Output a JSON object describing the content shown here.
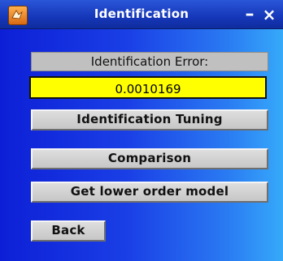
{
  "window": {
    "title": "Identification",
    "minimize_glyph": "–",
    "close_glyph": "×",
    "icon": "matlab-logo-icon"
  },
  "identification": {
    "error_label": "Identification Error:",
    "error_value": "0.0010169"
  },
  "buttons": {
    "identification_tuning": "Identification Tuning",
    "comparison": "Comparison",
    "lower_order_model": "Get lower order model",
    "back": "Back"
  },
  "colors": {
    "error_value_background": "#ffff00",
    "window_gradient_start": "#0d1fd6",
    "window_gradient_end": "#36a9fa"
  }
}
